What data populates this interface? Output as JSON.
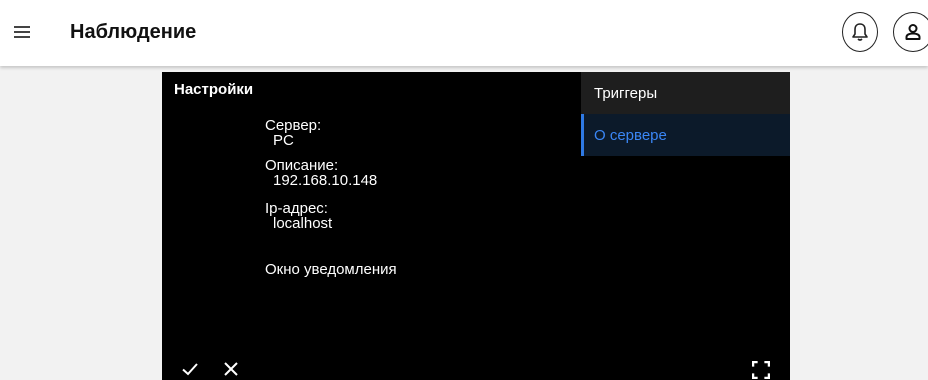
{
  "header": {
    "title": "Наблюдение",
    "menu_icon": "hamburger-menu-icon",
    "notification_icon": "bell-icon",
    "user_icon": "user-icon"
  },
  "player": {
    "settings_title": "Настройки",
    "server_label": "Сервер:",
    "server_value": "PC",
    "description_label": "Описание:",
    "description_value": "192.168.10.148",
    "ip_label": "Ip-адрес:",
    "ip_value": "localhost",
    "notification_window": "Окно уведомления",
    "side_menu": [
      {
        "label": "Триггеры",
        "active": false
      },
      {
        "label": "О сервере",
        "active": true
      }
    ],
    "controls": {
      "ok_icon": "checkmark-icon",
      "close_icon": "close-icon",
      "fullscreen_icon": "fullscreen-icon"
    }
  },
  "colors": {
    "accent": "#3a86f5",
    "player_background": "#000000",
    "page_background": "#f2f2f2"
  }
}
